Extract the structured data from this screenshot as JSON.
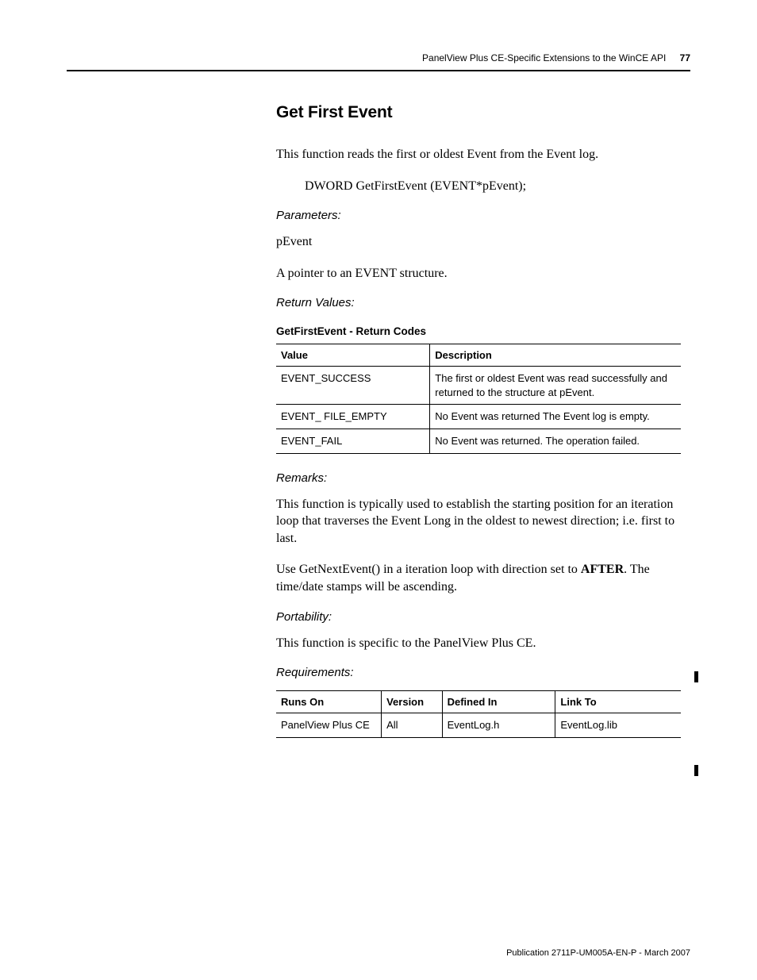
{
  "header": {
    "running_title": "PanelView Plus CE-Specific Extensions to the WinCE API",
    "page_number": "77"
  },
  "section": {
    "title": "Get First Event",
    "intro": "This function reads the first or oldest Event from the Event log.",
    "signature": "DWORD GetFirstEvent (EVENT*pEvent);",
    "parameters_label": "Parameters:",
    "param_name": "pEvent",
    "param_desc": "A pointer to an EVENT structure.",
    "return_values_label": "Return Values:",
    "return_table": {
      "title": "GetFirstEvent - Return Codes",
      "headers": [
        "Value",
        "Description"
      ],
      "rows": [
        [
          "EVENT_SUCCESS",
          "The first or oldest Event was read successfully and returned to the structure at pEvent."
        ],
        [
          "EVENT_ FILE_EMPTY",
          "No Event was returned The Event log is empty."
        ],
        [
          "EVENT_FAIL",
          "No Event was returned. The operation failed."
        ]
      ]
    },
    "remarks_label": "Remarks:",
    "remarks_p1": "This function is typically used to establish the starting position for an iteration loop that traverses the Event Long in the oldest to newest direction; i.e. first to last.",
    "remarks_p2_a": "Use GetNextEvent() in a iteration loop with direction set to ",
    "remarks_p2_b": "AFTER",
    "remarks_p2_c": ". The time/date stamps will be ascending.",
    "portability_label": "Portability:",
    "portability_text": "This function is specific to the PanelView Plus CE.",
    "requirements_label": "Requirements:",
    "req_table": {
      "headers": [
        "Runs On",
        "Version",
        "Defined In",
        "Link To"
      ],
      "rows": [
        [
          "PanelView Plus CE",
          "All",
          "EventLog.h",
          "EventLog.lib"
        ]
      ]
    }
  },
  "footer": {
    "publication": "Publication 2711P-UM005A-EN-P - March 2007"
  }
}
